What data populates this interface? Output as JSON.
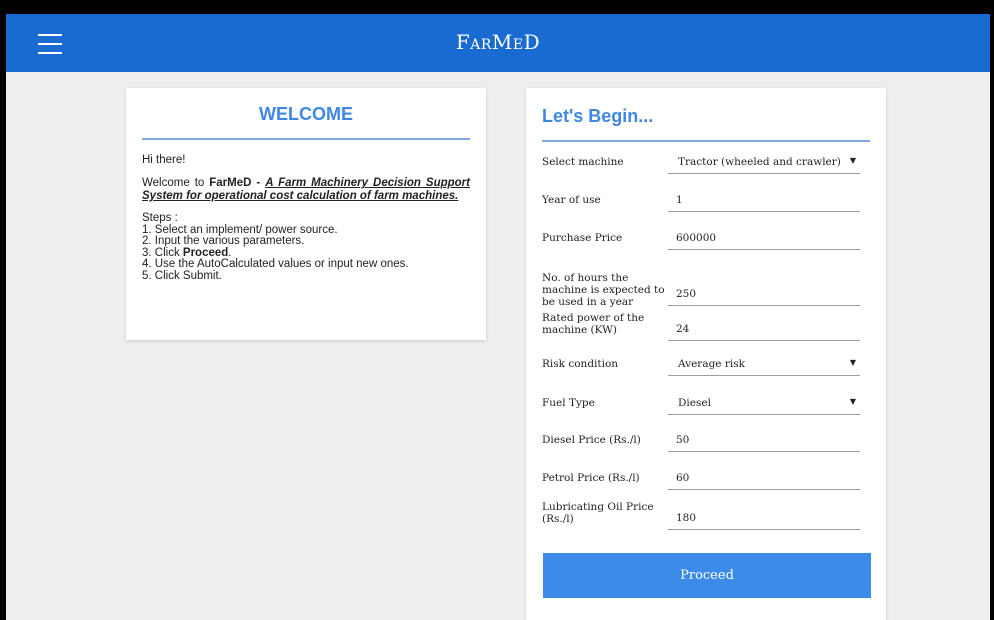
{
  "header": {
    "title": "FarMeD",
    "menu_icon": "hamburger-menu-icon",
    "bg_color": "#1a6bd1"
  },
  "welcome": {
    "title": "WELCOME",
    "greeting": "Hi there!",
    "intro_prefix": "Welcome to ",
    "intro_brand": "FarMeD",
    "intro_dash": " - ",
    "intro_tagline": "A Farm Machinery Decision Support System for operational cost calculation of farm machines.",
    "steps_heading": "Steps :",
    "step1": "1. Select an implement/ power source.",
    "step2": "2. Input the various parameters.",
    "step3_prefix": "3. Click ",
    "step3_bold": "Proceed",
    "step3_suffix": ".",
    "step4": "4. Use the AutoCalculated values or input new ones.",
    "step5": "5. Click Submit."
  },
  "form": {
    "title": "Let's Begin...",
    "machine_label": "Select machine",
    "machine_value": "Tractor (wheeled and crawler)",
    "year_label": "Year of use",
    "year_value": "1",
    "price_label": "Purchase Price",
    "price_value": "600000",
    "hours_label": "No. of hours the machine is expected to be used in a year",
    "hours_value": "250",
    "power_label": "Rated power of the machine (KW)",
    "power_value": "24",
    "risk_label": "Risk condition",
    "risk_value": "Average risk",
    "fuel_label": "Fuel Type",
    "fuel_value": "Diesel",
    "diesel_label": "Diesel Price (Rs./l)",
    "diesel_value": "50",
    "petrol_label": "Petrol Price (Rs./l)",
    "petrol_value": "60",
    "oil_label": "Lubricating Oil Price (Rs./l)",
    "oil_value": "180",
    "proceed_label": "Proceed",
    "accent_color": "#3f87e5"
  }
}
